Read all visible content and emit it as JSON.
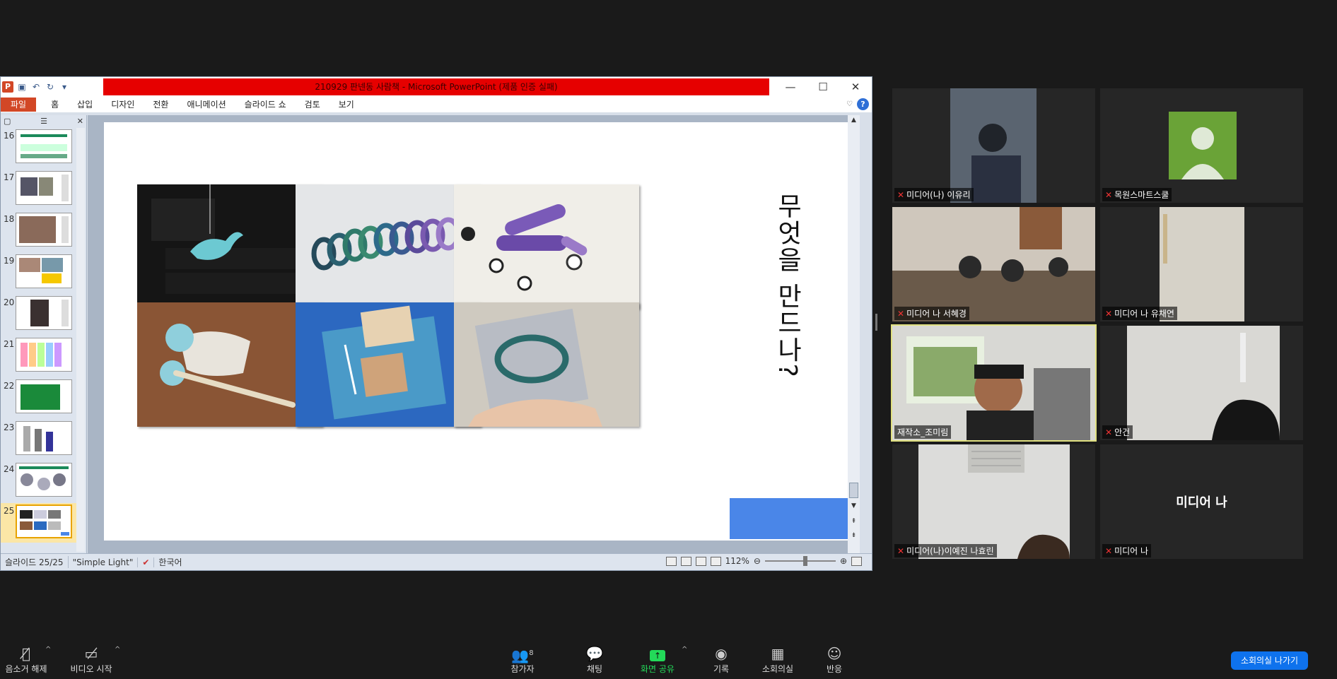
{
  "ppt": {
    "title": "210929 판넨동 사람책 - Microsoft PowerPoint (제품 인증 실패)",
    "tabs": [
      "파일",
      "홈",
      "삽입",
      "디자인",
      "전환",
      "애니메이션",
      "슬라이드 쇼",
      "검토",
      "보기"
    ],
    "thumb_numbers": [
      "16",
      "17",
      "18",
      "19",
      "20",
      "21",
      "22",
      "23",
      "24",
      "25"
    ],
    "slide_title": "무엇을 만드나?",
    "status": {
      "slide": "슬라이드 25/25",
      "theme": "\"Simple Light\"",
      "lang": "한국어",
      "zoom": "112%"
    },
    "window_controls": {
      "minimize": "—",
      "maximize": "☐",
      "close": "✕"
    }
  },
  "participants": [
    {
      "name": "미디어(나) 이유리",
      "muted": true
    },
    {
      "name": "목원스마트스쿨",
      "muted": true
    },
    {
      "name": "미디어 나 서혜경",
      "muted": true
    },
    {
      "name": "미디어 나 유채연",
      "muted": true
    },
    {
      "name": "재작소_조미림",
      "muted": false
    },
    {
      "name": "안건",
      "muted": true
    },
    {
      "name": "미디어(나)이예진 나효린",
      "muted": true
    },
    {
      "name": "미디어 나",
      "muted": true,
      "display_text": "미디어 나"
    }
  ],
  "toolbar": {
    "unmute": "음소거 해제",
    "start_video": "비디오 시작",
    "participants": "참가자",
    "participants_count": "8",
    "chat": "채팅",
    "share": "화면 공유",
    "record": "기록",
    "breakout": "소회의실",
    "reactions": "반응",
    "leave_breakout": "소회의실 나가기"
  },
  "colors": {
    "ppt_title_red": "#e60000",
    "zoom_blue": "#0e72ed",
    "share_green": "#23d959",
    "speaker_outline": "#e0e080"
  }
}
